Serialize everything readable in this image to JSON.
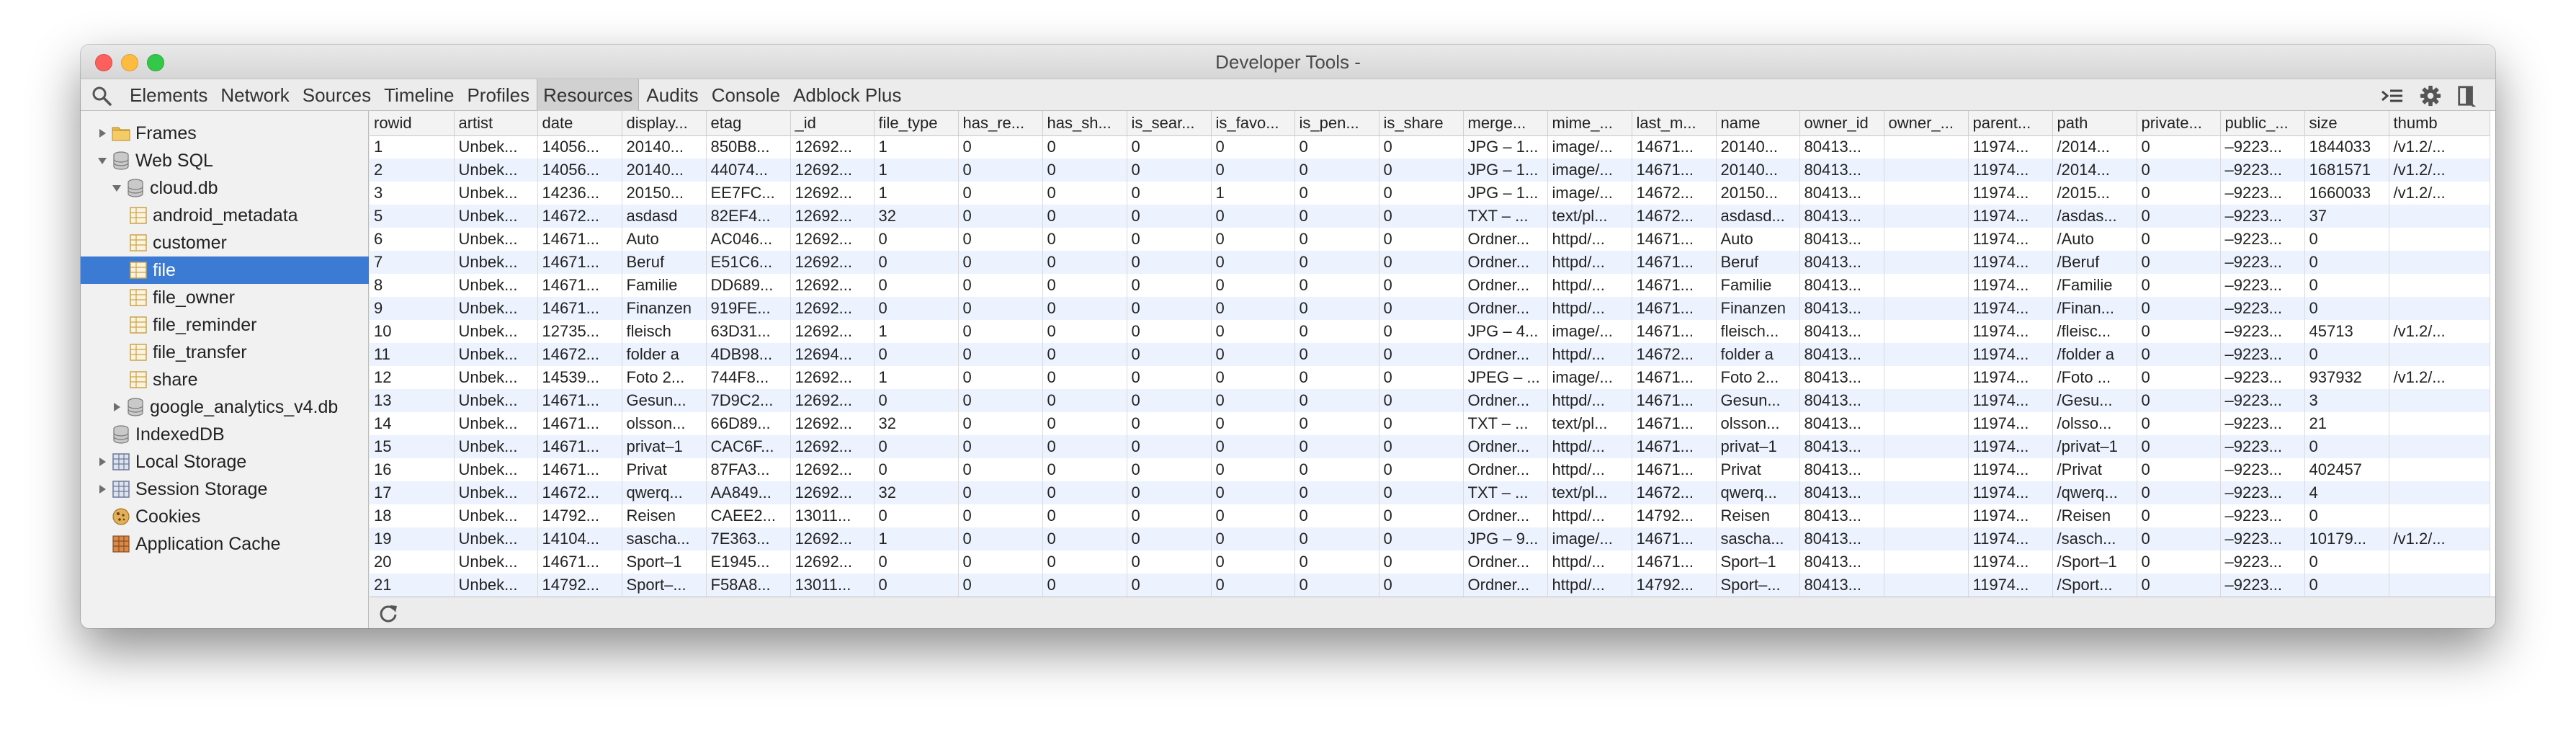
{
  "window": {
    "title": "Developer Tools -"
  },
  "toolbar": {
    "tabs": [
      {
        "label": "Elements",
        "active": false
      },
      {
        "label": "Network",
        "active": false
      },
      {
        "label": "Sources",
        "active": false
      },
      {
        "label": "Timeline",
        "active": false
      },
      {
        "label": "Profiles",
        "active": false
      },
      {
        "label": "Resources",
        "active": true
      },
      {
        "label": "Audits",
        "active": false
      },
      {
        "label": "Console",
        "active": false
      },
      {
        "label": "Adblock Plus",
        "active": false
      }
    ],
    "icons": [
      "search-icon",
      "console-drawer-icon",
      "gear-icon",
      "dock-side-icon"
    ]
  },
  "sidebar": {
    "items": [
      {
        "label": "Frames",
        "level": 0,
        "expand": "collapsed",
        "icon": "folder"
      },
      {
        "label": "Web SQL",
        "level": 0,
        "expand": "expanded",
        "icon": "database"
      },
      {
        "label": "cloud.db",
        "level": 1,
        "expand": "expanded",
        "icon": "database"
      },
      {
        "label": "android_metadata",
        "level": 2,
        "expand": "none",
        "icon": "table"
      },
      {
        "label": "customer",
        "level": 2,
        "expand": "none",
        "icon": "table"
      },
      {
        "label": "file",
        "level": 2,
        "expand": "none",
        "icon": "table",
        "selected": true
      },
      {
        "label": "file_owner",
        "level": 2,
        "expand": "none",
        "icon": "table"
      },
      {
        "label": "file_reminder",
        "level": 2,
        "expand": "none",
        "icon": "table"
      },
      {
        "label": "file_transfer",
        "level": 2,
        "expand": "none",
        "icon": "table"
      },
      {
        "label": "share",
        "level": 2,
        "expand": "none",
        "icon": "table"
      },
      {
        "label": "google_analytics_v4.db",
        "level": 1,
        "expand": "collapsed",
        "icon": "database"
      },
      {
        "label": "IndexedDB",
        "level": 0,
        "expand": "none",
        "icon": "database"
      },
      {
        "label": "Local Storage",
        "level": 0,
        "expand": "collapsed",
        "icon": "grid"
      },
      {
        "label": "Session Storage",
        "level": 0,
        "expand": "collapsed",
        "icon": "grid"
      },
      {
        "label": "Cookies",
        "level": 0,
        "expand": "none",
        "icon": "cookie"
      },
      {
        "label": "Application Cache",
        "level": 0,
        "expand": "none",
        "icon": "appcache"
      }
    ]
  },
  "table": {
    "columns": [
      "rowid",
      "artist",
      "date",
      "display...",
      "etag",
      "_id",
      "file_type",
      "has_re...",
      "has_sh...",
      "is_sear...",
      "is_favo...",
      "is_pen...",
      "is_share",
      "merge...",
      "mime_...",
      "last_m...",
      "name",
      "owner_id",
      "owner_...",
      "parent...",
      "path",
      "private...",
      "public_...",
      "size",
      "thumb"
    ],
    "rows": [
      [
        "1",
        "Unbek...",
        "14056...",
        "20140...",
        "850B8...",
        "12692...",
        "1",
        "0",
        "0",
        "0",
        "0",
        "0",
        "0",
        "JPG – 1...",
        "image/...",
        "14671...",
        "20140...",
        "80413...",
        "",
        "11974...",
        "/2014...",
        "0",
        "–9223...",
        "1844033",
        "/v1.2/..."
      ],
      [
        "2",
        "Unbek...",
        "14056...",
        "20140...",
        "44074...",
        "12692...",
        "1",
        "0",
        "0",
        "0",
        "0",
        "0",
        "0",
        "JPG – 1...",
        "image/...",
        "14671...",
        "20140...",
        "80413...",
        "",
        "11974...",
        "/2014...",
        "0",
        "–9223...",
        "1681571",
        "/v1.2/..."
      ],
      [
        "3",
        "Unbek...",
        "14236...",
        "20150...",
        "EE7FC...",
        "12692...",
        "1",
        "0",
        "0",
        "0",
        "1",
        "0",
        "0",
        "JPG – 1...",
        "image/...",
        "14672...",
        "20150...",
        "80413...",
        "",
        "11974...",
        "/2015...",
        "0",
        "–9223...",
        "1660033",
        "/v1.2/..."
      ],
      [
        "5",
        "Unbek...",
        "14672...",
        "asdasd",
        "82EF4...",
        "12692...",
        "32",
        "0",
        "0",
        "0",
        "0",
        "0",
        "0",
        "TXT – ...",
        "text/pl...",
        "14672...",
        "asdasd...",
        "80413...",
        "",
        "11974...",
        "/asdas...",
        "0",
        "–9223...",
        "37",
        ""
      ],
      [
        "6",
        "Unbek...",
        "14671...",
        "Auto",
        "AC046...",
        "12692...",
        "0",
        "0",
        "0",
        "0",
        "0",
        "0",
        "0",
        "Ordner...",
        "httpd/...",
        "14671...",
        "Auto",
        "80413...",
        "",
        "11974...",
        "/Auto",
        "0",
        "–9223...",
        "0",
        ""
      ],
      [
        "7",
        "Unbek...",
        "14671...",
        "Beruf",
        "E51C6...",
        "12692...",
        "0",
        "0",
        "0",
        "0",
        "0",
        "0",
        "0",
        "Ordner...",
        "httpd/...",
        "14671...",
        "Beruf",
        "80413...",
        "",
        "11974...",
        "/Beruf",
        "0",
        "–9223...",
        "0",
        ""
      ],
      [
        "8",
        "Unbek...",
        "14671...",
        "Familie",
        "DD689...",
        "12692...",
        "0",
        "0",
        "0",
        "0",
        "0",
        "0",
        "0",
        "Ordner...",
        "httpd/...",
        "14671...",
        "Familie",
        "80413...",
        "",
        "11974...",
        "/Familie",
        "0",
        "–9223...",
        "0",
        ""
      ],
      [
        "9",
        "Unbek...",
        "14671...",
        "Finanzen",
        "919FE...",
        "12692...",
        "0",
        "0",
        "0",
        "0",
        "0",
        "0",
        "0",
        "Ordner...",
        "httpd/...",
        "14671...",
        "Finanzen",
        "80413...",
        "",
        "11974...",
        "/Finan...",
        "0",
        "–9223...",
        "0",
        ""
      ],
      [
        "10",
        "Unbek...",
        "12735...",
        "fleisch",
        "63D31...",
        "12692...",
        "1",
        "0",
        "0",
        "0",
        "0",
        "0",
        "0",
        "JPG – 4...",
        "image/...",
        "14671...",
        "fleisch...",
        "80413...",
        "",
        "11974...",
        "/fleisc...",
        "0",
        "–9223...",
        "45713",
        "/v1.2/..."
      ],
      [
        "11",
        "Unbek...",
        "14672...",
        "folder a",
        "4DB98...",
        "12694...",
        "0",
        "0",
        "0",
        "0",
        "0",
        "0",
        "0",
        "Ordner...",
        "httpd/...",
        "14672...",
        "folder a",
        "80413...",
        "",
        "11974...",
        "/folder a",
        "0",
        "–9223...",
        "0",
        ""
      ],
      [
        "12",
        "Unbek...",
        "14539...",
        "Foto 2...",
        "744F8...",
        "12692...",
        "1",
        "0",
        "0",
        "0",
        "0",
        "0",
        "0",
        "JPEG – ...",
        "image/...",
        "14671...",
        "Foto 2...",
        "80413...",
        "",
        "11974...",
        "/Foto ...",
        "0",
        "–9223...",
        "937932",
        "/v1.2/..."
      ],
      [
        "13",
        "Unbek...",
        "14671...",
        "Gesun...",
        "7D9C2...",
        "12692...",
        "0",
        "0",
        "0",
        "0",
        "0",
        "0",
        "0",
        "Ordner...",
        "httpd/...",
        "14671...",
        "Gesun...",
        "80413...",
        "",
        "11974...",
        "/Gesu...",
        "0",
        "–9223...",
        "3",
        ""
      ],
      [
        "14",
        "Unbek...",
        "14671...",
        "olsson...",
        "66D89...",
        "12692...",
        "32",
        "0",
        "0",
        "0",
        "0",
        "0",
        "0",
        "TXT – ...",
        "text/pl...",
        "14671...",
        "olsson...",
        "80413...",
        "",
        "11974...",
        "/olsso...",
        "0",
        "–9223...",
        "21",
        ""
      ],
      [
        "15",
        "Unbek...",
        "14671...",
        "privat–1",
        "CAC6F...",
        "12692...",
        "0",
        "0",
        "0",
        "0",
        "0",
        "0",
        "0",
        "Ordner...",
        "httpd/...",
        "14671...",
        "privat–1",
        "80413...",
        "",
        "11974...",
        "/privat–1",
        "0",
        "–9223...",
        "0",
        ""
      ],
      [
        "16",
        "Unbek...",
        "14671...",
        "Privat",
        "87FA3...",
        "12692...",
        "0",
        "0",
        "0",
        "0",
        "0",
        "0",
        "0",
        "Ordner...",
        "httpd/...",
        "14671...",
        "Privat",
        "80413...",
        "",
        "11974...",
        "/Privat",
        "0",
        "–9223...",
        "402457",
        ""
      ],
      [
        "17",
        "Unbek...",
        "14672...",
        "qwerq...",
        "AA849...",
        "12692...",
        "32",
        "0",
        "0",
        "0",
        "0",
        "0",
        "0",
        "TXT – ...",
        "text/pl...",
        "14672...",
        "qwerq...",
        "80413...",
        "",
        "11974...",
        "/qwerq...",
        "0",
        "–9223...",
        "4",
        ""
      ],
      [
        "18",
        "Unbek...",
        "14792...",
        "Reisen",
        "CAEE2...",
        "13011...",
        "0",
        "0",
        "0",
        "0",
        "0",
        "0",
        "0",
        "Ordner...",
        "httpd/...",
        "14792...",
        "Reisen",
        "80413...",
        "",
        "11974...",
        "/Reisen",
        "0",
        "–9223...",
        "0",
        ""
      ],
      [
        "19",
        "Unbek...",
        "14104...",
        "sascha...",
        "7E363...",
        "12692...",
        "1",
        "0",
        "0",
        "0",
        "0",
        "0",
        "0",
        "JPG – 9...",
        "image/...",
        "14671...",
        "sascha...",
        "80413...",
        "",
        "11974...",
        "/sasch...",
        "0",
        "–9223...",
        "10179...",
        "/v1.2/..."
      ],
      [
        "20",
        "Unbek...",
        "14671...",
        "Sport–1",
        "E1945...",
        "12692...",
        "0",
        "0",
        "0",
        "0",
        "0",
        "0",
        "0",
        "Ordner...",
        "httpd/...",
        "14671...",
        "Sport–1",
        "80413...",
        "",
        "11974...",
        "/Sport–1",
        "0",
        "–9223...",
        "0",
        ""
      ],
      [
        "21",
        "Unbek...",
        "14792...",
        "Sport–...",
        "F58A8...",
        "13011...",
        "0",
        "0",
        "0",
        "0",
        "0",
        "0",
        "0",
        "Ordner...",
        "httpd/...",
        "14792...",
        "Sport–...",
        "80413...",
        "",
        "11974...",
        "/Sport...",
        "0",
        "–9223...",
        "0",
        ""
      ]
    ]
  },
  "statusbar": {
    "icons": [
      "refresh-icon"
    ]
  },
  "colors": {
    "selection": "#3b7bd4",
    "stripe": "#edf3fe",
    "folder": "#e8b84a",
    "table_icon": "#c9a44e"
  }
}
